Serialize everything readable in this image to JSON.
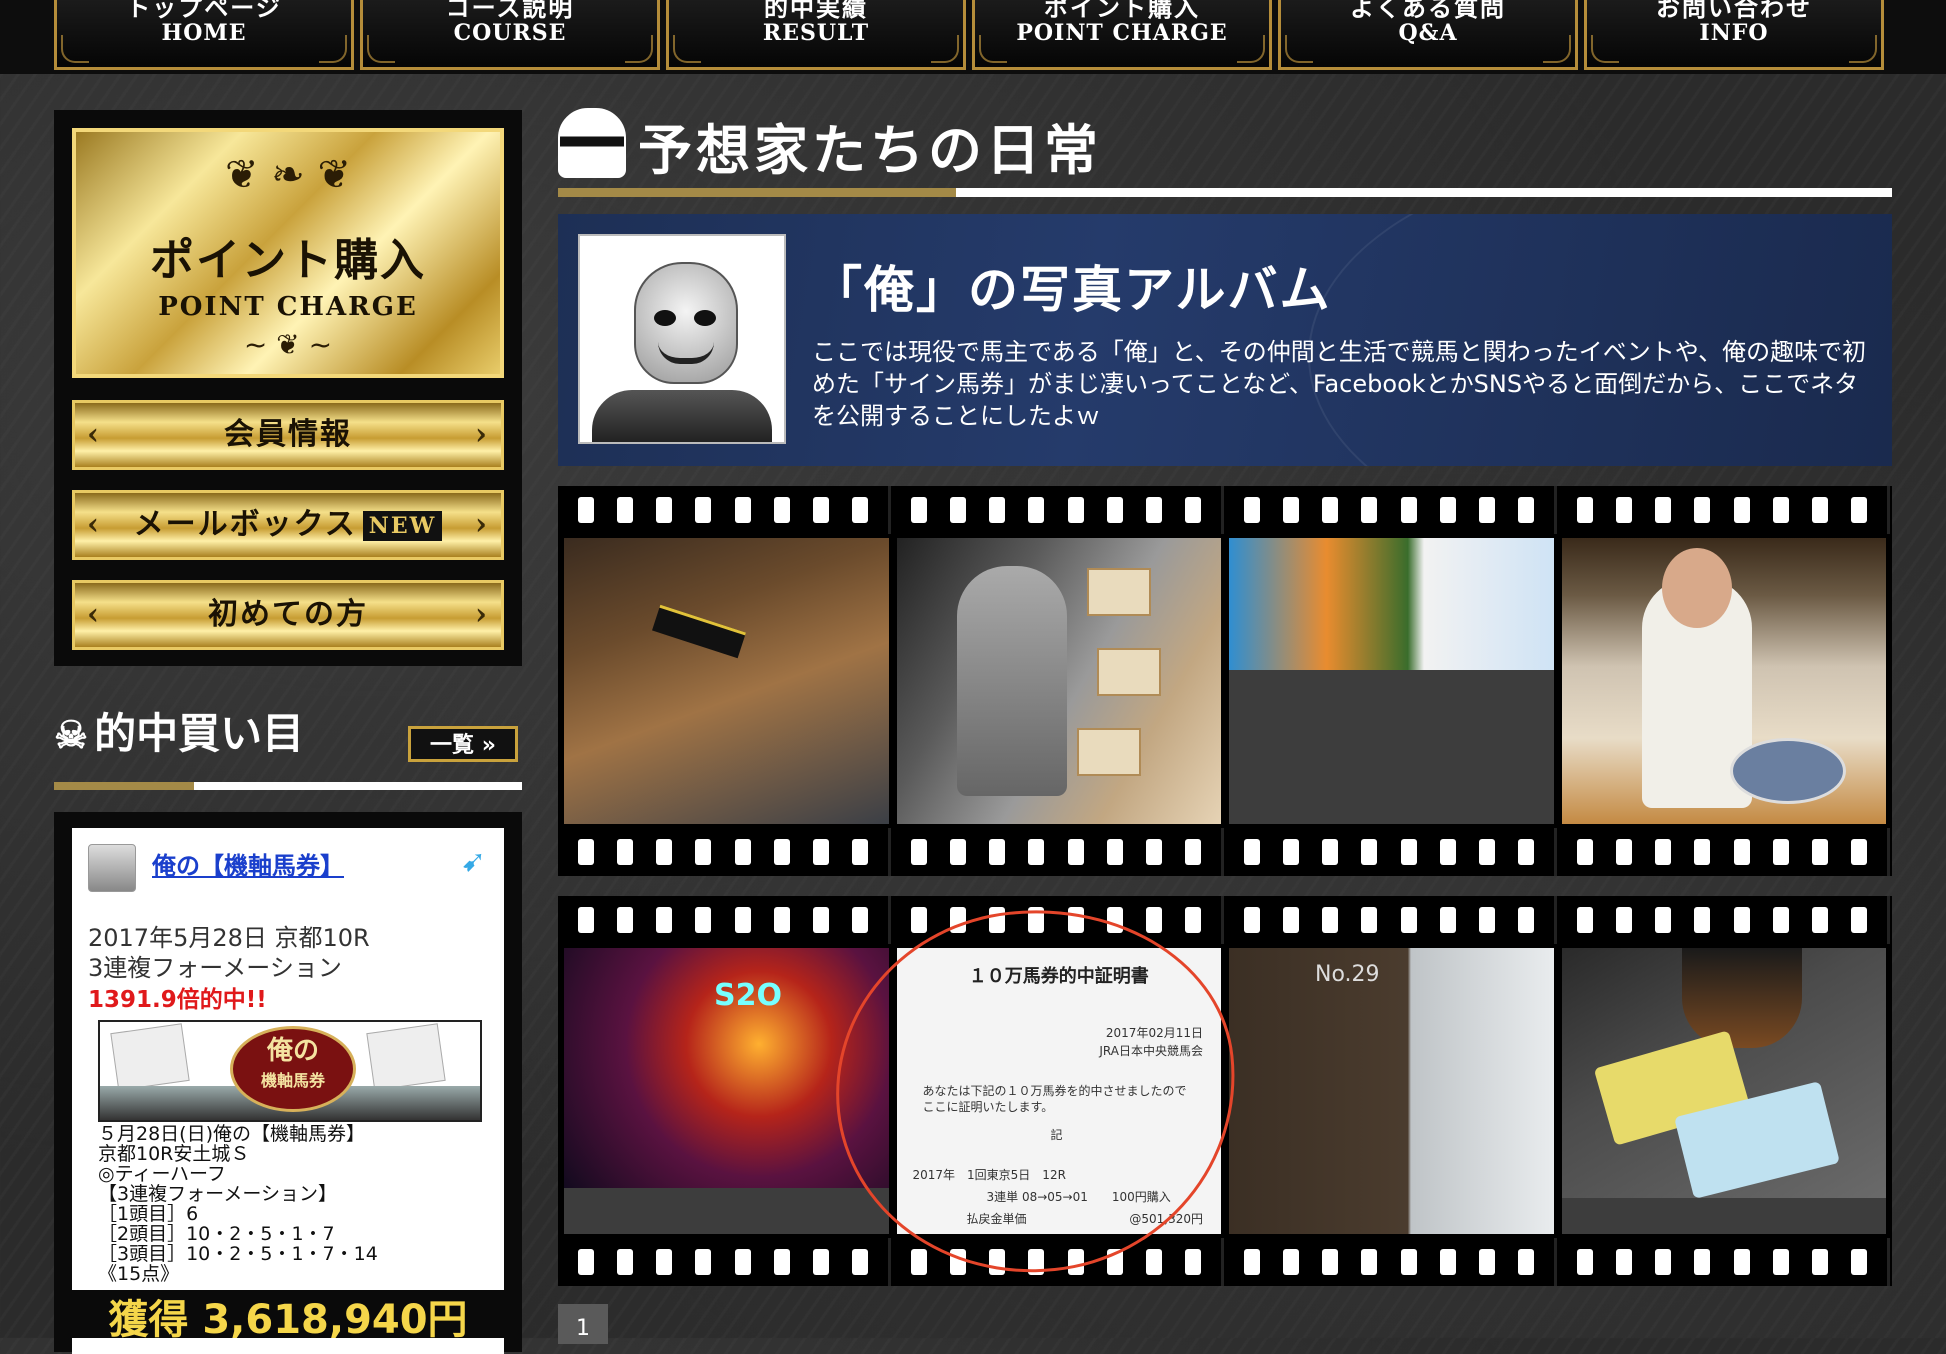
{
  "nav": [
    {
      "jp": "トップページ",
      "en": "HOME"
    },
    {
      "jp": "コース説明",
      "en": "COURSE"
    },
    {
      "jp": "的中実績",
      "en": "RESULT"
    },
    {
      "jp": "ポイント購入",
      "en": "POINT CHARGE"
    },
    {
      "jp": "よくある質問",
      "en": "Q&A"
    },
    {
      "jp": "お問い合わせ",
      "en": "INFO"
    }
  ],
  "sidebar": {
    "point": {
      "jp": "ポイント購入",
      "en": "POINT CHARGE"
    },
    "member_label": "会員情報",
    "mailbox_label": "メールボックス",
    "mailbox_badge": "NEW",
    "beginner_label": "初めての方"
  },
  "hit": {
    "heading": "的中買い目",
    "list_label": "一覧",
    "name": "俺の【機軸馬券】",
    "date": "2017年5月28日 京都10R",
    "type": "3連複フォーメーション",
    "odds": "1391.9倍的中!!",
    "badge_top": "俺の",
    "badge_bottom": "機軸馬券",
    "details": [
      "５月28日(日)俺の【機軸馬券】",
      "京都10R安土城Ｓ",
      "◎ティーハーフ",
      "【3連複フォーメーション】",
      "［1頭目］6",
      "［2頭目］10・2・5・1・7",
      "［3頭目］10・2・5・1・7・14",
      "《15点》"
    ],
    "prize": "獲得 3,618,940円"
  },
  "main": {
    "heading": "予想家たちの日常",
    "album_title": "「俺」の写真アルバム",
    "album_desc": "ここでは現役で馬主である「俺」と、その仲間と生活で競馬と関わったイベントや、俺の趣味で初めた「サイン馬券」がまじ凄いってことなど、FacebookとかSNSやると面倒だから、ここでネタを公開することにしたよｗ"
  },
  "certificate": {
    "title": "１０万馬券的中証明書",
    "date": "2017年02月11日",
    "issuer": "JRA日本中央競馬会",
    "body1": "あなたは下記の１０万馬券を的中させましたので",
    "body2": "ここに証明いたします。",
    "ki": "記",
    "race": "2017年　1回東京5日　12R",
    "bet": "3連単 08→05→01　　100円購入",
    "payout_label": "払戻金単価",
    "payout": "@501,320円"
  },
  "photo_sign": "No.29",
  "pager": "1"
}
